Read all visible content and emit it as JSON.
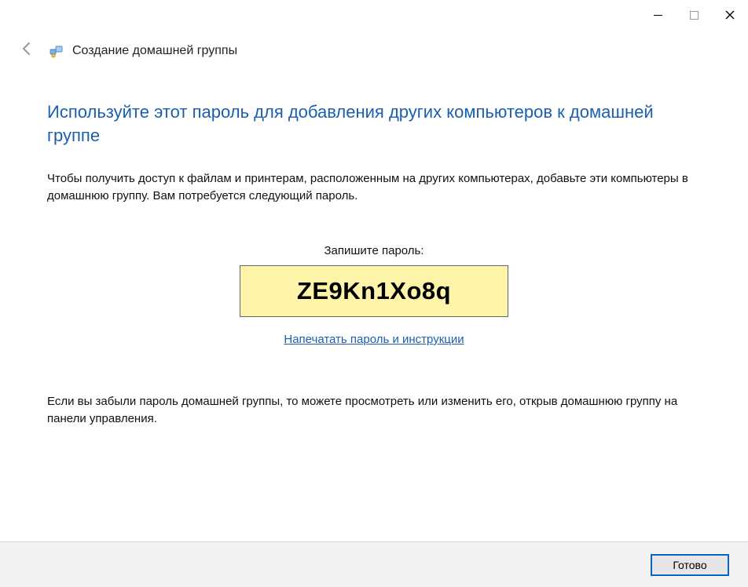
{
  "window": {
    "title": "Создание домашней группы"
  },
  "main": {
    "heading": "Используйте этот пароль для добавления других компьютеров к домашней группе",
    "description": "Чтобы получить доступ к файлам и принтерам, расположенным на других компьютерах, добавьте эти компьютеры в домашнюю группу. Вам потребуется следующий пароль.",
    "password_label": "Запишите пароль:",
    "password": "ZE9Kn1Xo8q",
    "print_link": "Напечатать пароль и инструкции",
    "note": "Если вы забыли пароль домашней группы, то можете просмотреть или изменить его, открыв домашнюю группу на панели управления."
  },
  "footer": {
    "finish_label": "Готово"
  }
}
